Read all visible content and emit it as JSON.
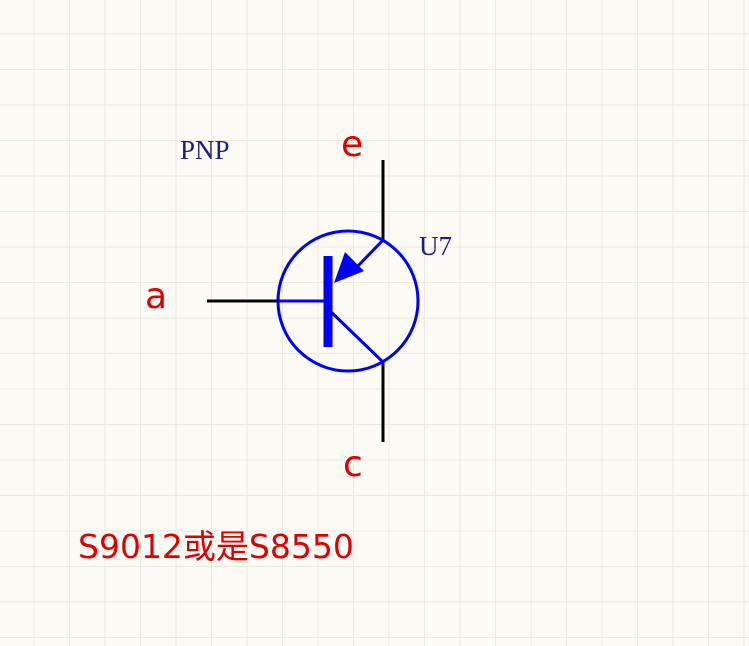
{
  "component": {
    "type_label": "PNP",
    "designator": "U7"
  },
  "pins": {
    "emitter": "e",
    "base": "a",
    "collector": "c"
  },
  "note": "S9012或是S8550",
  "colors": {
    "symbol": "#0000ff",
    "wire": "#000000",
    "part_text": "#1c1c8a",
    "pin_text": "#e00000",
    "grid": "#ece9dd",
    "background": "#fcfbf6"
  }
}
